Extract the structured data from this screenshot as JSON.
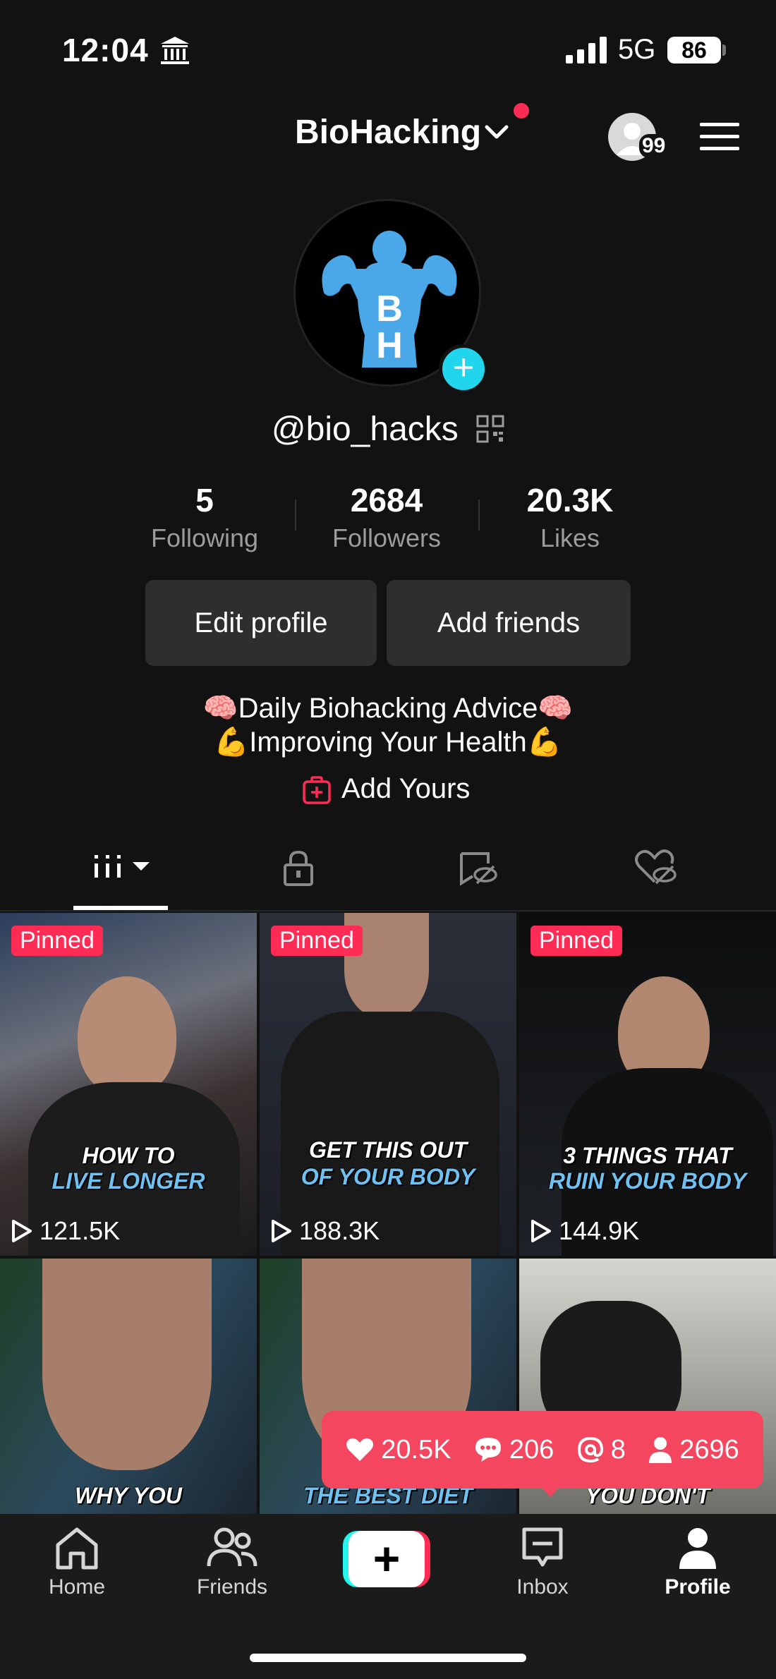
{
  "status_bar": {
    "time": "12:04",
    "network": "5G",
    "battery": "86"
  },
  "header": {
    "account_name": "BioHacking",
    "profile_views_count": "99"
  },
  "profile": {
    "avatar_text": "BH",
    "handle": "@bio_hacks",
    "stats": [
      {
        "value": "5",
        "label": "Following"
      },
      {
        "value": "2684",
        "label": "Followers"
      },
      {
        "value": "20.3K",
        "label": "Likes"
      }
    ],
    "buttons": {
      "edit": "Edit profile",
      "add_friends": "Add friends"
    },
    "bio": [
      "🧠Daily Biohacking Advice🧠",
      "💪Improving Your Health💪"
    ],
    "add_yours": "Add Yours"
  },
  "videos": [
    {
      "pinned": "Pinned",
      "views": "121.5K",
      "caption_1": "HOW TO",
      "caption_2": "LIVE LONGER"
    },
    {
      "pinned": "Pinned",
      "views": "188.3K",
      "caption_1": "GET THIS OUT",
      "caption_2": "OF YOUR BODY"
    },
    {
      "pinned": "Pinned",
      "views": "144.9K",
      "caption_1": "3 THINGS THAT",
      "caption_2": "RUIN YOUR BODY"
    },
    {
      "caption_1": "WHY YOU"
    },
    {
      "caption_1": "THE BEST DIET"
    },
    {
      "caption_1": "YOU DON'T"
    }
  ],
  "video_stats_popup": {
    "likes": "20.5K",
    "comments": "206",
    "mentions": "8",
    "followers": "2696"
  },
  "bottom_nav": [
    {
      "label": "Home"
    },
    {
      "label": "Friends"
    },
    {
      "label": "Inbox"
    },
    {
      "label": "Profile"
    }
  ],
  "colors": {
    "accent_red": "#fe2c55",
    "accent_cyan": "#25f4ee",
    "background": "#121212"
  }
}
